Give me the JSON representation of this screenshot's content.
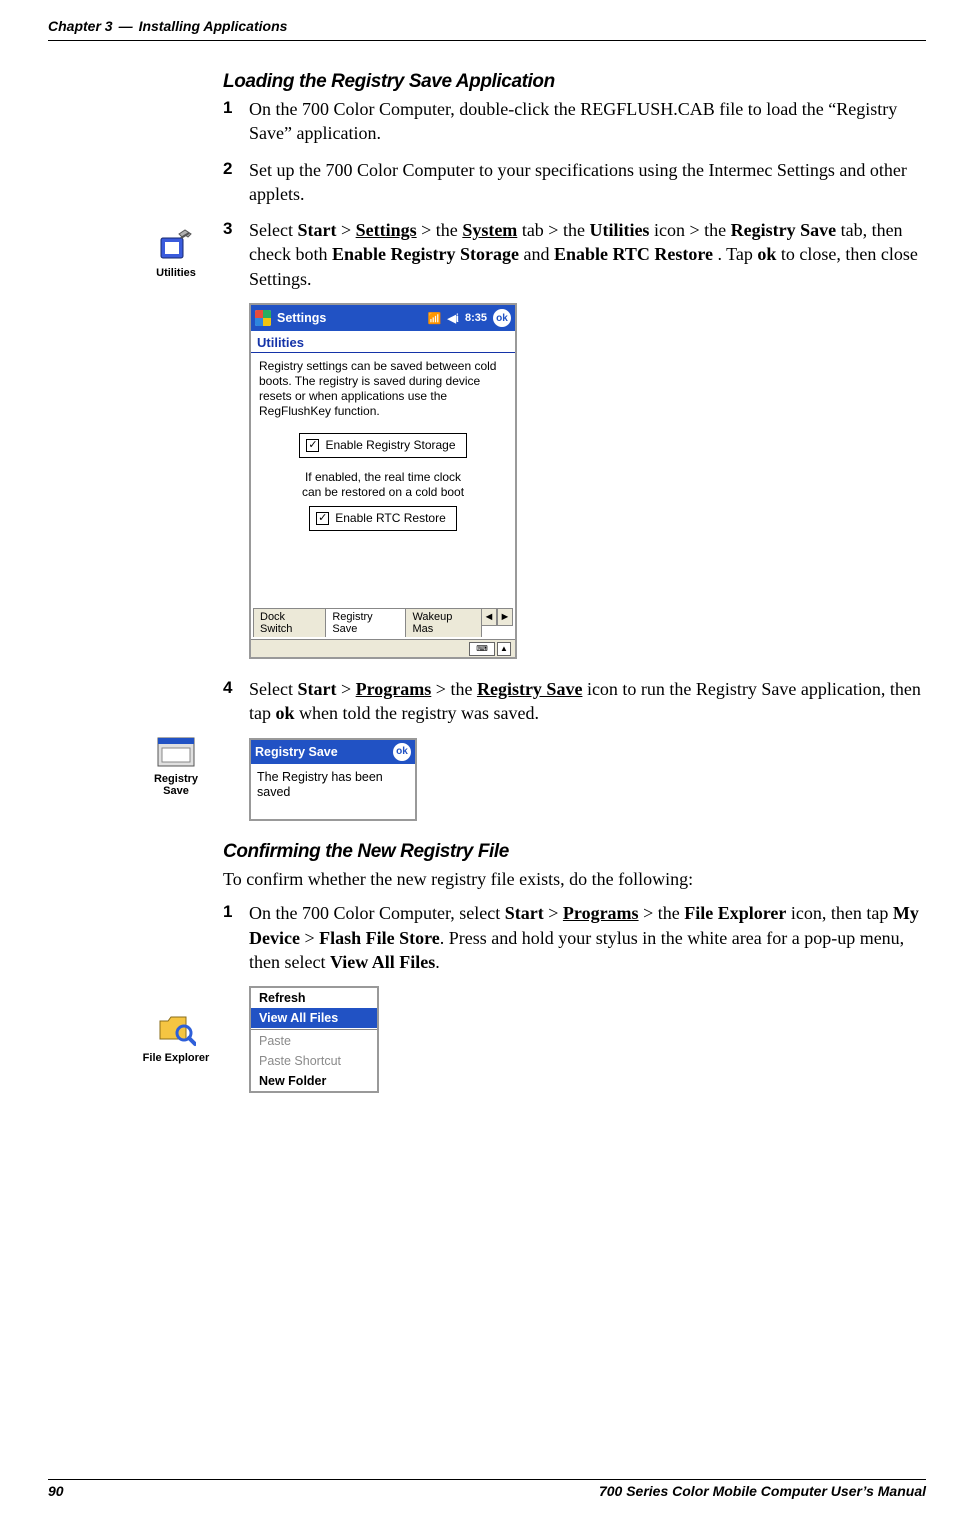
{
  "header": {
    "chapter": "Chapter 3",
    "sep": "—",
    "title": "Installing Applications"
  },
  "section1": {
    "title": "Loading the Registry Save Application",
    "step1_num": "1",
    "step1": "On the 700 Color Computer, double-click the REGFLUSH.CAB file to load the “Registry Save” application.",
    "step2_num": "2",
    "step2": "Set up the 700 Color Computer to your specifications using the Intermec Settings and other applets.",
    "step3_num": "3",
    "step3_a": "Select ",
    "step3_start": "Start",
    "step3_gt1": " > ",
    "step3_settings": "Settings",
    "step3_gt2": " > the ",
    "step3_system": "System",
    "step3_tab": " tab > the ",
    "step3_util": "Utilities",
    "step3_icon": " icon > the ",
    "step3_regsave": "Registry Save",
    "step3_b": " tab, then check both ",
    "step3_ers": "Enable Registry Storage",
    "step3_and": " and ",
    "step3_rtc": "Enable RTC Restore",
    "step3_tap": " . Tap ",
    "step3_ok": "ok",
    "step3_end": " to close, then close Settings.",
    "step4_num": "4",
    "step4_a": "Select ",
    "step4_start": "Start",
    "step4_gt1": " > ",
    "step4_programs": "Programs",
    "step4_gt2": " > the ",
    "step4_regsave": "Registry Save",
    "step4_mid": " icon to run the Registry Save application, then tap ",
    "step4_ok": "ok",
    "step4_end": " when told the registry was saved."
  },
  "margin_icons": {
    "utilities": "Utilities",
    "registry_save": "Registry\nSave",
    "file_explorer": "File Explorer"
  },
  "settings_shot": {
    "title": "Settings",
    "time": "8:35",
    "ok": "ok",
    "subhead": "Utilities",
    "desc": "Registry settings can be saved between cold boots. The registry is saved during device resets or when applications use the RegFlushKey function.",
    "chk1": "Enable Registry Storage",
    "rtc_note1": "If enabled, the real time clock",
    "rtc_note2": "can be restored on a cold boot",
    "chk2": "Enable RTC Restore",
    "tab1": "Dock Switch",
    "tab2": "Registry Save",
    "tab3": "Wakeup Mas"
  },
  "regsave_shot": {
    "title": "Registry Save",
    "ok": "ok",
    "body": "The Registry has been saved"
  },
  "section2": {
    "title": "Confirming the New Registry File",
    "intro": "To confirm whether the new registry file exists, do the following:",
    "step1_num": "1",
    "s1_a": "On the 700 Color Computer, select ",
    "s1_start": "Start",
    "s1_gt1": " > ",
    "s1_programs": "Programs",
    "s1_gt2": " > the ",
    "s1_fe": "File Explorer",
    "s1_mid1": " icon, then tap ",
    "s1_mydev": "My Device",
    "s1_gt3": " > ",
    "s1_ffs": "Flash File Store",
    "s1_mid2": ". Press and hold your stylus in the white area for a pop-up menu, then select ",
    "s1_vaf": "View All Files",
    "s1_end": "."
  },
  "ctx": {
    "refresh": "Refresh",
    "view_all": "View All Files",
    "paste": "Paste",
    "paste_sc": "Paste Shortcut",
    "new_folder": "New Folder"
  },
  "footer": {
    "page": "90",
    "book": "700 Series Color Mobile Computer User’s Manual"
  }
}
